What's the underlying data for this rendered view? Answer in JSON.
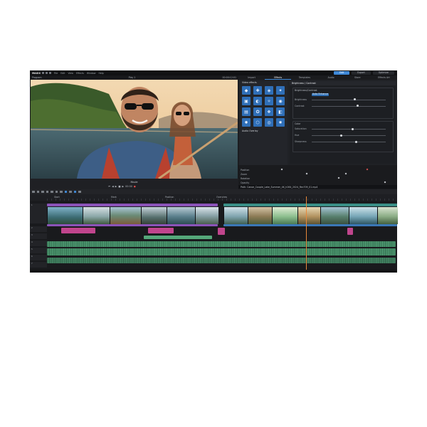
{
  "app": {
    "logo": "MAGIX",
    "menu": [
      "File",
      "Edit",
      "View",
      "Effects",
      "Window",
      "Help"
    ],
    "workspace_tabs": [
      {
        "label": "Edit",
        "active": true
      },
      {
        "label": "Export",
        "active": false
      },
      {
        "label": "Optimize",
        "active": false
      }
    ]
  },
  "preview": {
    "left_label": "Program",
    "center_label": "Play 1",
    "right_label": "00:00:12:01",
    "footer_label": "Movie",
    "timecode": "00:00"
  },
  "effects": {
    "tabs": [
      "Import",
      "Effects",
      "Templates",
      "Audio",
      "Store",
      "Effects Art"
    ],
    "active_tab": "Effects",
    "list_header": "Video effects",
    "items": [
      {
        "icon": "◆"
      },
      {
        "icon": "✚"
      },
      {
        "icon": "◈"
      },
      {
        "icon": "✦"
      },
      {
        "icon": "▣"
      },
      {
        "icon": "◐"
      },
      {
        "icon": "✧"
      },
      {
        "icon": "◉"
      },
      {
        "icon": "▤"
      },
      {
        "icon": "✪"
      },
      {
        "icon": "❖"
      },
      {
        "icon": "◧"
      },
      {
        "icon": "✹"
      },
      {
        "icon": "⬡"
      },
      {
        "icon": "◎"
      },
      {
        "icon": "✸"
      }
    ],
    "footer_header": "Audio Overlay",
    "properties": {
      "title": "Brightness / Contrast",
      "group1": "Brightness/Contrast",
      "preset": "Auto Enhance",
      "params1": [
        {
          "label": "Brightness",
          "value": 0.58
        },
        {
          "label": "Contrast",
          "value": 0.62
        }
      ],
      "group2": "Color",
      "params2": [
        {
          "label": "Saturation",
          "value": 0.55
        },
        {
          "label": "Hue",
          "value": 0.4
        },
        {
          "label": "Sharpness",
          "value": 0.6
        }
      ]
    }
  },
  "keyframes": {
    "rows": [
      "Position",
      "Zoom",
      "Rotation",
      "Opacity"
    ],
    "path_row": "Path: Canoe_Couple_Lake_Summer_4K_h264_2024_Rec709_01.mp4"
  },
  "timeline": {
    "ruler_labels": [
      "Start",
      "Mark",
      "Position",
      "Overview"
    ],
    "track_labels": [
      "1",
      "2",
      "3",
      "4",
      "5",
      "6",
      "7"
    ]
  },
  "colors": {
    "accent": "#3f88d6",
    "video_track": "#8b53b8",
    "title_track": "#c0458d",
    "audio_track": "#55a87a",
    "playhead": "#e8883a"
  }
}
